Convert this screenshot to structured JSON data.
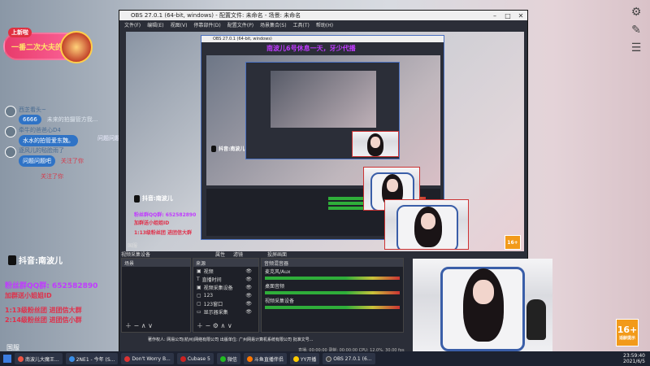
{
  "colors": {
    "accent_blue": "#2f73c6",
    "pink_banner": "#ff2fd0",
    "purple_banner": "#c03aff",
    "red_text": "#e0304a",
    "age_badge": "#f29a1a"
  },
  "sidebar": {
    "icons": [
      "gear-icon",
      "wrench-icon",
      "menu-icon"
    ]
  },
  "logo": {
    "tag": "上新啦",
    "text": "一番二次大夫的坐方"
  },
  "chat": {
    "items": [
      {
        "name": "西芝看头~",
        "text": "6666",
        "extra": "未来的拍摄管方我..."
      },
      {
        "name": "牵牛的爸爸心D4",
        "text": "水水的拍管爱东魏。",
        "extra": ""
      },
      {
        "name": "逐风儿的毡脸雨了",
        "text": "问题问题吧",
        "extra": "关注了你"
      }
    ],
    "follow_notice": "关注了你",
    "side_label": "问题问题吧"
  },
  "obs": {
    "title": "OBS 27.0.1 (64-bit, windows) - 配置文件: 未命名 - 场景: 未命名",
    "menu": [
      "文件(F)",
      "编辑(E)",
      "视图(V)",
      "停靠部件(D)",
      "配置文件(P)",
      "场景集合(S)",
      "工具(T)",
      "帮助(H)"
    ],
    "banner": "南波儿6号休息一天，牙少代播",
    "nested_title": "OBS 27.0.1 (64-bit, windows)",
    "scene_label": "国服",
    "sources_header": "场景",
    "sources_dock": "来源",
    "mixer_header": "音频混音器",
    "sources": [
      {
        "label": "视频"
      },
      {
        "label": "直播时间"
      },
      {
        "label": "视频采集设备"
      },
      {
        "label": "123"
      },
      {
        "label": "123窗口"
      },
      {
        "label": "显示器采集"
      }
    ],
    "mixer_tracks": [
      {
        "label": "麦克风/Aux",
        "db": "0.0 dB"
      },
      {
        "label": "桌面音频",
        "db": "0.0 dB"
      },
      {
        "label": "视频采集设备",
        "db": "0.0 dB"
      }
    ],
    "toolbar": {
      "properties": "属性",
      "filters": "滤镜",
      "device_label": "视频采集设备",
      "screen_cast": "投屏画面"
    },
    "status": {
      "line": "直播: 00:00:00  录制: 00:00:00  CPU: 12.0%, 30.00 fps"
    }
  },
  "overlay": {
    "douyin_name": "抖音:南波儿",
    "fan_qq": "粉丝群QQ群: 652582890",
    "fan_tip": "加群送小姐姐ID",
    "rule1": "1:13级粉丝团 进团信大群",
    "rule2": "2:14级粉丝团 进团信小群",
    "age_badge_num": "16+",
    "age_badge_text": "适龄提示",
    "scroll_notice": "著作权人: 网易公司(杭州)网络有限公司 出版单位: 广州网易计算机系统有限公司 批准文号..."
  },
  "taskbar": {
    "items": [
      "南波儿大魔王...",
      "2NE1 - 今年 (S...",
      "Don't Worry B...",
      "Cubase 5",
      "微信",
      "斗鱼直播伴侣",
      "YY开播",
      "OBS 27.0.1 (6..."
    ],
    "clock": "23:59:40",
    "date": "2021/6/5"
  }
}
